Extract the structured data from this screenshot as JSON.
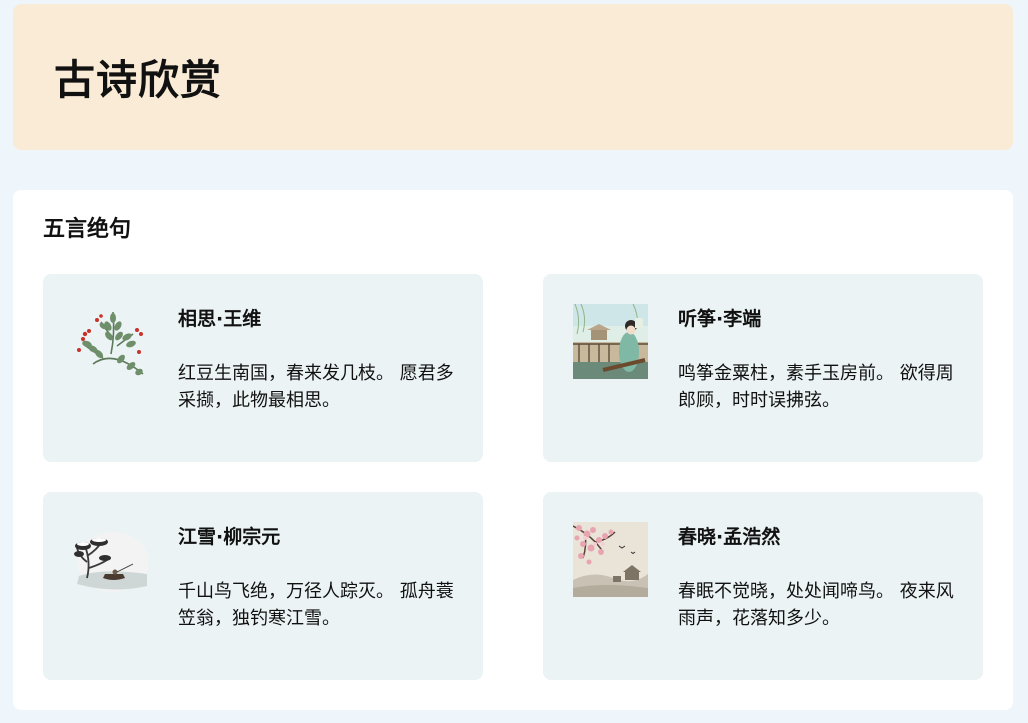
{
  "header": {
    "title": "古诗欣赏"
  },
  "section": {
    "title": "五言绝句",
    "poems": [
      {
        "title": "相思·王维",
        "text": "红豆生南国，春来发几枝。 愿君多采撷，此物最相思。",
        "icon": "red-bean-branch-illustration"
      },
      {
        "title": "听筝·李端",
        "text": "鸣筝金粟柱，素手玉房前。 欲得周郎顾，时时误拂弦。",
        "icon": "zither-player-illustration"
      },
      {
        "title": "江雪·柳宗元",
        "text": "千山鸟飞绝，万径人踪灭。 孤舟蓑笠翁，独钓寒江雪。",
        "icon": "snowy-river-boat-illustration"
      },
      {
        "title": "春晓·孟浩然",
        "text": "春眠不觉晓，处处闻啼鸟。 夜来风雨声，花落知多少。",
        "icon": "spring-blossom-landscape-illustration"
      }
    ]
  }
}
